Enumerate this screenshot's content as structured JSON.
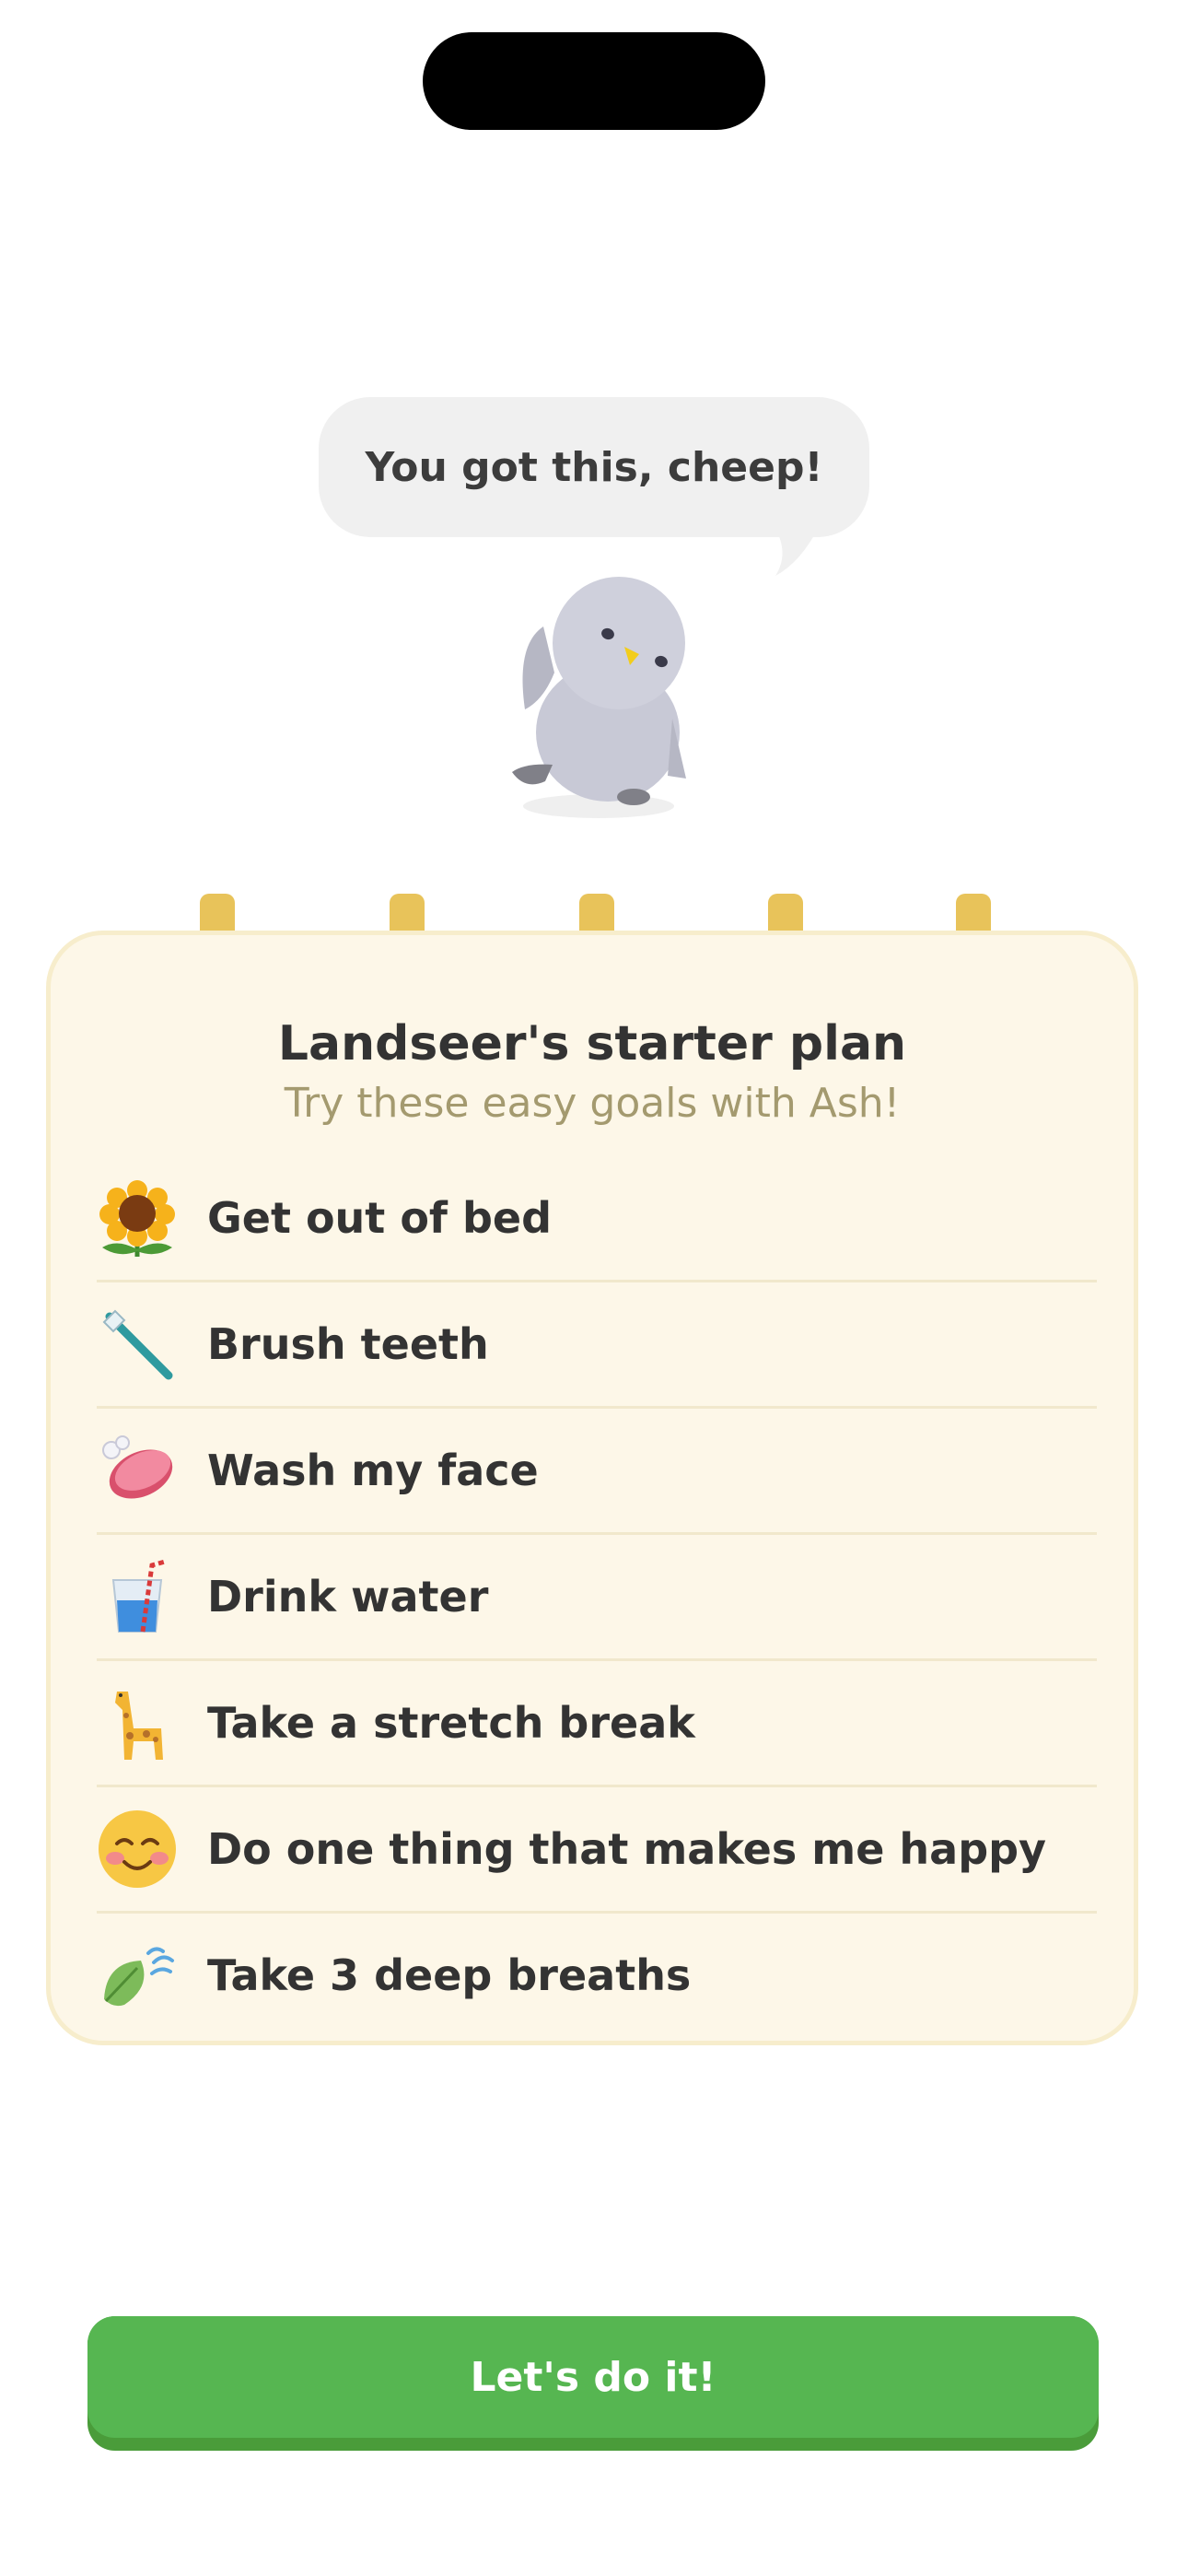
{
  "speech_bubble": {
    "text": "You got this, cheep!"
  },
  "plan_card": {
    "title": "Landseer's starter plan",
    "subtitle": "Try these easy goals with Ash!",
    "goals": [
      {
        "label": "Get out of bed",
        "icon": "sunflower-icon"
      },
      {
        "label": "Brush teeth",
        "icon": "toothbrush-icon"
      },
      {
        "label": "Wash my face",
        "icon": "soap-icon"
      },
      {
        "label": "Drink water",
        "icon": "water-glass-icon"
      },
      {
        "label": "Take a stretch break",
        "icon": "giraffe-icon"
      },
      {
        "label": "Do one thing that makes me happy",
        "icon": "smiling-face-icon"
      },
      {
        "label": "Take 3 deep breaths",
        "icon": "leaf-wind-icon"
      }
    ]
  },
  "cta_button": {
    "label": "Let's do it!"
  },
  "colors": {
    "accent_green": "#56b651",
    "card_bg": "#fdf7e8",
    "ring_yellow": "#e8c35a",
    "subtitle": "#a49a6f"
  }
}
